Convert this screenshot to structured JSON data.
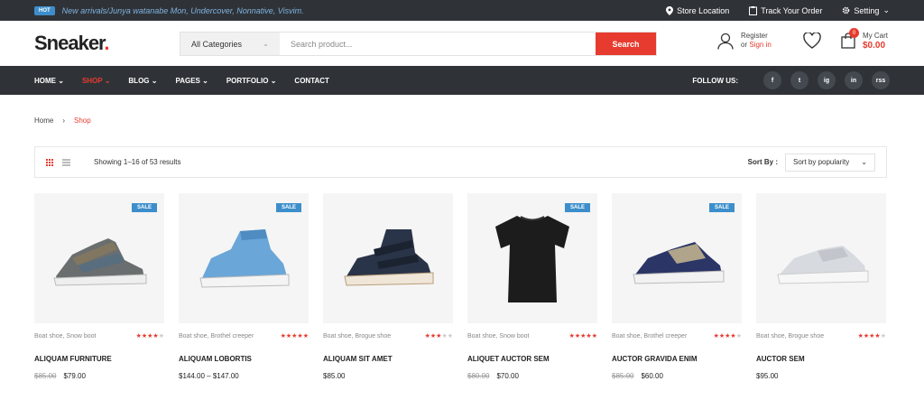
{
  "topbar": {
    "hot_badge": "HOT",
    "announcement": "New arrivals/Junya watanabe Mon, Undercover, Nonnative, Visvim.",
    "store_location": "Store Location",
    "track_order": "Track Your Order",
    "setting": "Setting"
  },
  "header": {
    "logo_main": "Sneaker",
    "logo_dot": ".",
    "category": "All Categories",
    "search_placeholder": "Search product...",
    "search_button": "Search",
    "register": "Register",
    "or_label": "or",
    "sign_in": "Sign in",
    "cart_count": "0",
    "cart_label": "My Cart",
    "cart_amount": "$0.00"
  },
  "nav": {
    "items": [
      "HOME",
      "SHOP",
      "BLOG",
      "PAGES",
      "PORTFOLIO",
      "CONTACT"
    ],
    "follow": "FOLLOW US:",
    "social": [
      "f",
      "t",
      "ig",
      "in",
      "rss"
    ]
  },
  "breadcrumb": {
    "home": "Home",
    "sep": "›",
    "current": "Shop"
  },
  "toolbar": {
    "results": "Showing 1–16 of 53 results",
    "sort_label": "Sort By :",
    "sort_value": "Sort by popularity"
  },
  "products": [
    {
      "categories": "Boat shoe, Snow boot",
      "rating": 4,
      "name": "ALIQUAM FURNITURE",
      "old_price": "$85.00",
      "price": "$79.00",
      "sale": true,
      "sale_label": "SALE"
    },
    {
      "categories": "Boat shoe, Brothel creeper",
      "rating": 5,
      "name": "ALIQUAM LOBORTIS",
      "old_price": "",
      "price": "$144.00 – $147.00",
      "sale": true,
      "sale_label": "SALE"
    },
    {
      "categories": "Boat shoe, Brogue shoe",
      "rating": 3,
      "name": "ALIQUAM SIT AMET",
      "old_price": "",
      "price": "$85.00",
      "sale": false,
      "sale_label": ""
    },
    {
      "categories": "Boat shoe, Snow boot",
      "rating": 5,
      "name": "ALIQUET AUCTOR SEM",
      "old_price": "$80.00",
      "price": "$70.00",
      "sale": true,
      "sale_label": "SALE"
    },
    {
      "categories": "Boat shoe, Brothel creeper",
      "rating": 4,
      "name": "AUCTOR GRAVIDA ENIM",
      "old_price": "$85.00",
      "price": "$60.00",
      "sale": true,
      "sale_label": "SALE"
    },
    {
      "categories": "Boat shoe, Brogue shoe",
      "rating": 4,
      "name": "AUCTOR SEM",
      "old_price": "",
      "price": "$95.00",
      "sale": false,
      "sale_label": ""
    }
  ],
  "colors": {
    "accent": "#e63b2e",
    "dark": "#2f3338",
    "sale": "#3d8ecb"
  }
}
